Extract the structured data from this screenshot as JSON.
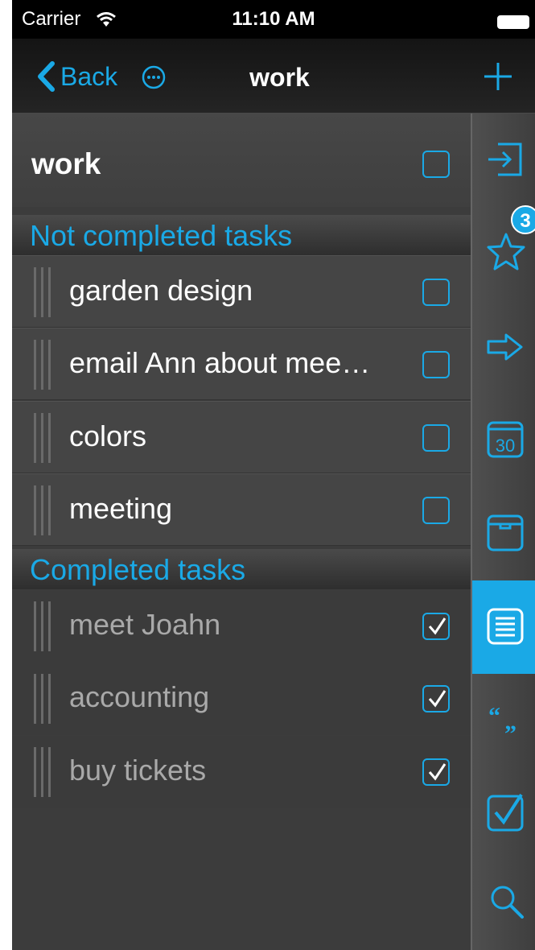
{
  "status_bar": {
    "carrier": "Carrier",
    "time": "11:10 AM"
  },
  "nav": {
    "back_label": "Back",
    "title": "work"
  },
  "list": {
    "name": "work",
    "sections": {
      "not_completed": "Not completed tasks",
      "completed": "Completed tasks"
    },
    "not_completed_tasks": [
      {
        "label": "garden design",
        "checked": false
      },
      {
        "label": "email Ann about mee…",
        "checked": false
      },
      {
        "label": "colors",
        "checked": false
      },
      {
        "label": "meeting",
        "checked": false
      }
    ],
    "completed_tasks": [
      {
        "label": "meet Joahn",
        "checked": true
      },
      {
        "label": "accounting",
        "checked": true
      },
      {
        "label": "buy tickets",
        "checked": true
      }
    ]
  },
  "toolbar": {
    "items": [
      {
        "icon": "inbox-icon"
      },
      {
        "icon": "star-icon",
        "badge": "3"
      },
      {
        "icon": "arrow-right-icon"
      },
      {
        "icon": "calendar-icon",
        "text": "30"
      },
      {
        "icon": "archive-icon"
      },
      {
        "icon": "list-icon",
        "active": true
      },
      {
        "icon": "quote-icon"
      },
      {
        "icon": "checkbox-icon"
      },
      {
        "icon": "search-icon"
      }
    ]
  },
  "colors": {
    "accent": "#1aa9e6",
    "background": "#3a3a3a"
  }
}
